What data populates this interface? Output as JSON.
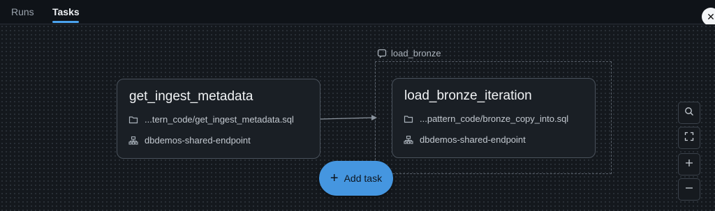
{
  "tabs": [
    {
      "label": "Runs",
      "active": false
    },
    {
      "label": "Tasks",
      "active": true
    }
  ],
  "close_icon": "close-icon",
  "group": {
    "label": "load_bronze",
    "icon": "loop-icon"
  },
  "tasks": [
    {
      "title": "get_ingest_metadata",
      "file": "...tern_code/get_ingest_metadata.sql",
      "endpoint": "dbdemos-shared-endpoint"
    },
    {
      "title": "load_bronze_iteration",
      "file": "...pattern_code/bronze_copy_into.sql",
      "endpoint": "dbdemos-shared-endpoint"
    }
  ],
  "add_task": {
    "label": "Add task"
  },
  "zoom_controls": [
    "search-icon",
    "fit-view-icon",
    "zoom-in-icon",
    "zoom-out-icon"
  ],
  "colors": {
    "accent": "#4596e0",
    "background": "#14181d",
    "card": "#1a1f25"
  }
}
